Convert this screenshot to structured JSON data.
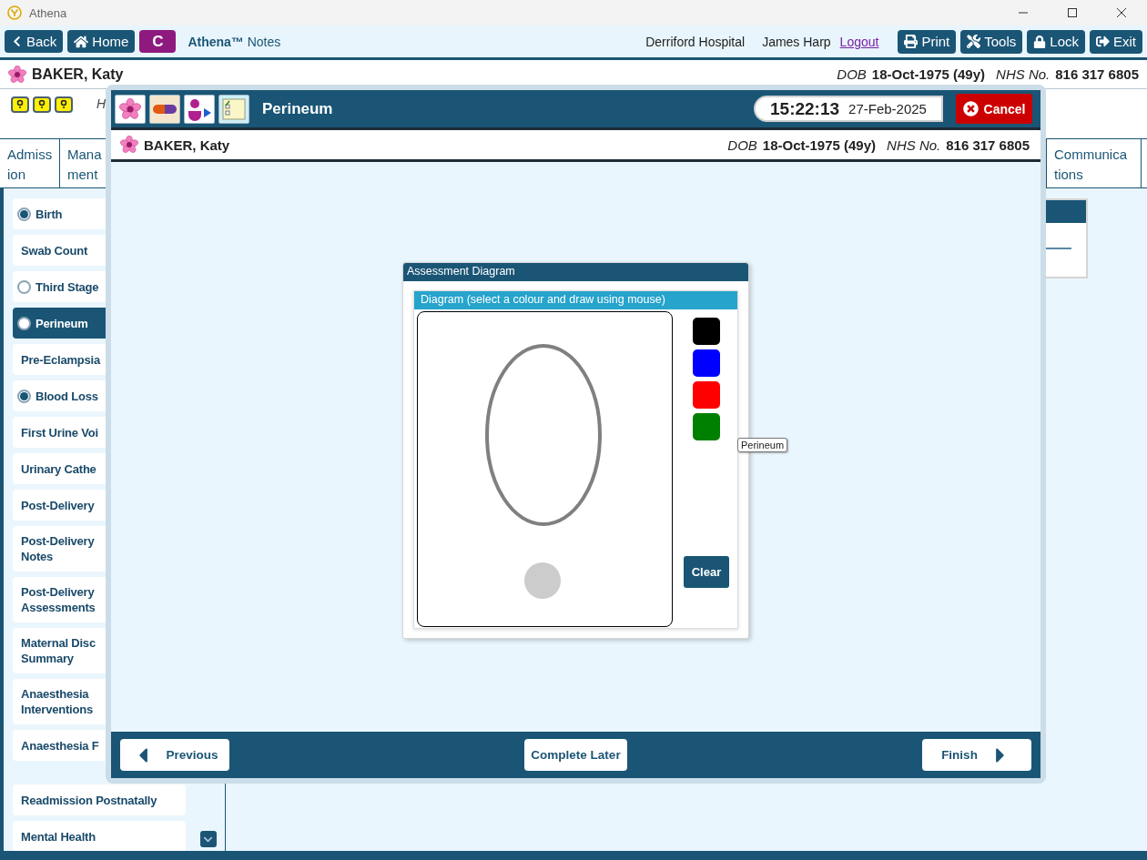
{
  "app_title": "Athena",
  "toolbar": {
    "buttons": [
      {
        "kind": "back",
        "label": "Back"
      },
      {
        "kind": "home",
        "label": "Home"
      }
    ],
    "badge": "C",
    "app_name": "**Athena™** Notes",
    "hospital": "Derriford Hospital",
    "user": "James Harp",
    "logout": "Logout",
    "actions": [
      {
        "kind": "print",
        "label": "Print"
      },
      {
        "kind": "tools",
        "label": "Tools"
      },
      {
        "kind": "lock",
        "label": "Lock"
      },
      {
        "kind": "exit",
        "label": "Exit"
      }
    ]
  },
  "patient": {
    "name": "BAKER, Katy",
    "dob_label": "DOB",
    "dob": "18-Oct-1975 (49y)",
    "nhs_label": "NHS No.",
    "nhs": "816 317 6805"
  },
  "info_row": {
    "text": "H"
  },
  "tabs": [
    {
      "lines": [
        "Admiss",
        "ion"
      ]
    },
    {
      "lines": [
        "Mana",
        "ment"
      ]
    },
    {
      "lines": [
        "Communica",
        "tions"
      ]
    }
  ],
  "sidebar": {
    "groups": [
      [
        {
          "label": "Birth",
          "kind": "radio",
          "checked": true,
          "selected": false
        },
        {
          "label": "Swab Count",
          "kind": "plain",
          "selected": false
        },
        {
          "label": "Third Stage",
          "kind": "radio",
          "checked": false,
          "selected": false
        },
        {
          "label": "Perineum",
          "kind": "radio",
          "checked": false,
          "selected": true
        },
        {
          "label": "Pre-Eclampsia",
          "kind": "plain",
          "selected": false
        },
        {
          "label": "Blood Loss",
          "kind": "radio",
          "checked": true,
          "selected": false
        },
        {
          "label": "First Urine Voi",
          "kind": "plain",
          "selected": false
        },
        {
          "label": "Urinary Cathe",
          "kind": "plain",
          "selected": false
        },
        {
          "label": "Post-Delivery",
          "kind": "plain",
          "selected": false
        },
        {
          "label": "Post-Delivery Notes",
          "kind": "plain",
          "selected": false
        },
        {
          "label": "Post-Delivery Assessments",
          "kind": "plain",
          "selected": false
        },
        {
          "label": "Maternal Disc Summary",
          "kind": "plain",
          "selected": false
        },
        {
          "label": "Anaesthesia Interventions",
          "kind": "plain",
          "selected": false
        },
        {
          "label": "Anaesthesia F",
          "kind": "plain",
          "selected": false
        }
      ],
      [
        {
          "label": "Readmission Postnatally",
          "kind": "plain",
          "selected": false
        },
        {
          "label": "Mental Health",
          "kind": "plain",
          "selected": false
        }
      ]
    ]
  },
  "modal": {
    "title": "Perineum",
    "time": "15:22:13",
    "date": "27-Feb-2025",
    "cancel": "Cancel",
    "patient": {
      "name": "BAKER, Katy",
      "dob_label": "DOB",
      "dob": "18-Oct-1975 (49y)",
      "nhs_label": "NHS No.",
      "nhs": "816 317 6805"
    },
    "panel": {
      "title": "Assessment Diagram",
      "subtitle": "Diagram (select a colour and draw using mouse)",
      "colours": [
        {
          "color": "#000000"
        },
        {
          "color": "#0000ff"
        },
        {
          "color": "#ff0000"
        },
        {
          "color": "#008000"
        }
      ],
      "clear": "Clear",
      "tooltip": "Perineum"
    },
    "footer": {
      "previous": "Previous",
      "later": "Complete Later",
      "finish": "Finish"
    }
  }
}
